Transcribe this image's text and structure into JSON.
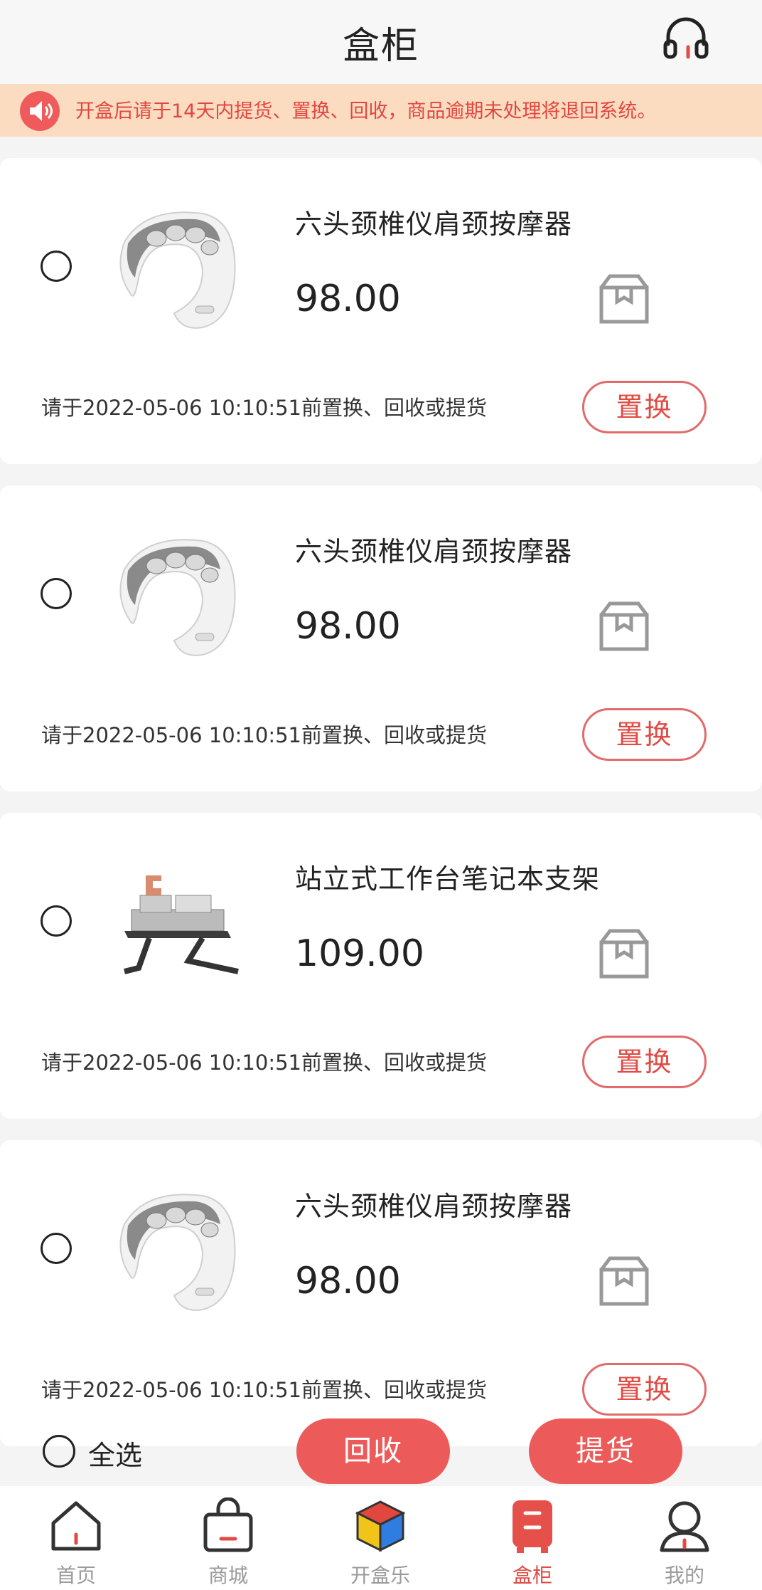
{
  "header": {
    "title": "盒柜",
    "support_icon": "headset-icon"
  },
  "notice": {
    "icon": "speaker-icon",
    "text": "开盒后请于14天内提货、置换、回收，商品逾期未处理将退回系统。"
  },
  "items": [
    {
      "name": "六头颈椎仪肩颈按摩器",
      "price": "98.00",
      "image": "neck-massager",
      "deadline": "请于2022-05-06 10:10:51前置换、回收或提货",
      "swap_label": "置换"
    },
    {
      "name": "六头颈椎仪肩颈按摩器",
      "price": "98.00",
      "image": "neck-massager",
      "deadline": "请于2022-05-06 10:10:51前置换、回收或提货",
      "swap_label": "置换"
    },
    {
      "name": "站立式工作台笔记本支架",
      "price": "109.00",
      "image": "laptop-stand",
      "deadline": "请于2022-05-06 10:10:51前置换、回收或提货",
      "swap_label": "置换"
    },
    {
      "name": "六头颈椎仪肩颈按摩器",
      "price": "98.00",
      "image": "neck-massager",
      "deadline": "请于2022-05-06 10:10:51前置换、回收或提货",
      "swap_label": "置换"
    }
  ],
  "actions": {
    "select_all": "全选",
    "recycle": "回收",
    "pickup": "提货"
  },
  "tabs": [
    {
      "label": "首页",
      "icon": "home-icon",
      "active": false
    },
    {
      "label": "商城",
      "icon": "shopping-bag-icon",
      "active": false
    },
    {
      "label": "开盒乐",
      "icon": "cube-icon",
      "active": false
    },
    {
      "label": "盒柜",
      "icon": "locker-icon",
      "active": true
    },
    {
      "label": "我的",
      "icon": "user-icon",
      "active": false
    }
  ],
  "colors": {
    "accent": "#ec5b59",
    "notice_bg": "#fbdcc1",
    "notice_text": "#e2473f"
  }
}
